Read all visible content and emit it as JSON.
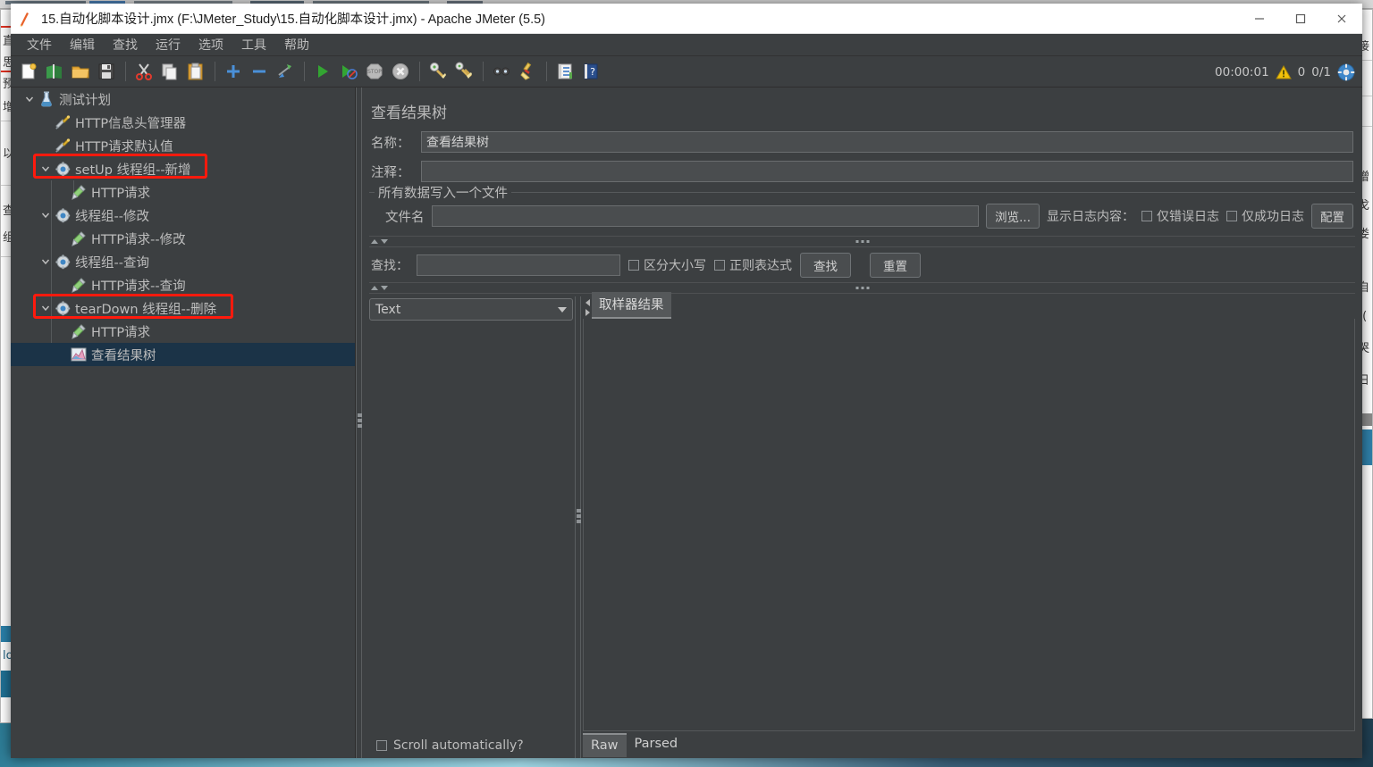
{
  "window": {
    "title": "15.自动化脚本设计.jmx (F:\\JMeter_Study\\15.自动化脚本设计.jmx) - Apache JMeter (5.5)",
    "minimize_label": "—",
    "maximize_label": "☐",
    "close_label": "✕"
  },
  "menubar": {
    "items": [
      {
        "label": "文件"
      },
      {
        "label": "编辑"
      },
      {
        "label": "查找"
      },
      {
        "label": "运行"
      },
      {
        "label": "选项"
      },
      {
        "label": "工具"
      },
      {
        "label": "帮助"
      }
    ]
  },
  "toolbar": {
    "buttons": [
      {
        "icon": "new-file-icon",
        "tooltip": "新建"
      },
      {
        "icon": "templates-icon",
        "tooltip": "模板"
      },
      {
        "icon": "open-folder-icon",
        "tooltip": "打开"
      },
      {
        "icon": "save-icon",
        "tooltip": "保存"
      },
      {
        "icon": "cut-icon",
        "tooltip": "剪切"
      },
      {
        "icon": "copy-icon",
        "tooltip": "复制"
      },
      {
        "icon": "paste-icon",
        "tooltip": "粘贴"
      },
      {
        "icon": "expand-all-icon",
        "tooltip": "展开"
      },
      {
        "icon": "collapse-all-icon",
        "tooltip": "折叠"
      },
      {
        "icon": "toggle-icon",
        "tooltip": "切换"
      },
      {
        "icon": "start-icon",
        "tooltip": "启动"
      },
      {
        "icon": "start-no-pauses-icon",
        "tooltip": "无间隔启动"
      },
      {
        "icon": "stop-icon",
        "tooltip": "停止"
      },
      {
        "icon": "shutdown-icon",
        "tooltip": "关闭"
      },
      {
        "icon": "clear-icon",
        "tooltip": "清除"
      },
      {
        "icon": "clear-all-icon",
        "tooltip": "清除全部"
      },
      {
        "icon": "search-icon",
        "tooltip": "搜索"
      },
      {
        "icon": "reset-search-icon",
        "tooltip": "重置搜索"
      },
      {
        "icon": "function-helper-icon",
        "tooltip": "函数助手"
      },
      {
        "icon": "help-icon",
        "tooltip": "帮助"
      }
    ]
  },
  "status": {
    "timer": "00:00:01",
    "warning_icon": "warning-triangle-icon",
    "warning_count": "0",
    "threads": "0/1",
    "connection_icon": "connection-icon"
  },
  "tree": {
    "nodes": [
      {
        "label": "测试计划",
        "icon": "test-plan-icon",
        "indent": 0,
        "twisty": "expanded",
        "selected": false,
        "annotated": false
      },
      {
        "label": "HTTP信息头管理器",
        "icon": "header-manager-icon",
        "indent": 1,
        "twisty": "none",
        "selected": false,
        "annotated": false
      },
      {
        "label": "HTTP请求默认值",
        "icon": "http-defaults-icon",
        "indent": 1,
        "twisty": "none",
        "selected": false,
        "annotated": false
      },
      {
        "label": "setUp 线程组--新增",
        "icon": "thread-group-icon",
        "indent": 1,
        "twisty": "expanded",
        "selected": false,
        "annotated": true
      },
      {
        "label": "HTTP请求",
        "icon": "http-sampler-icon",
        "indent": 2,
        "twisty": "none",
        "selected": false,
        "annotated": false
      },
      {
        "label": "线程组--修改",
        "icon": "thread-group-icon",
        "indent": 1,
        "twisty": "expanded",
        "selected": false,
        "annotated": false
      },
      {
        "label": "HTTP请求--修改",
        "icon": "http-sampler-icon",
        "indent": 2,
        "twisty": "none",
        "selected": false,
        "annotated": false
      },
      {
        "label": "线程组--查询",
        "icon": "thread-group-icon",
        "indent": 1,
        "twisty": "expanded",
        "selected": false,
        "annotated": false
      },
      {
        "label": "HTTP请求--查询",
        "icon": "http-sampler-icon",
        "indent": 2,
        "twisty": "none",
        "selected": false,
        "annotated": false
      },
      {
        "label": "tearDown 线程组--删除",
        "icon": "thread-group-icon",
        "indent": 1,
        "twisty": "expanded",
        "selected": false,
        "annotated": true
      },
      {
        "label": "HTTP请求",
        "icon": "http-sampler-icon",
        "indent": 2,
        "twisty": "none",
        "selected": false,
        "annotated": false
      },
      {
        "label": "查看结果树",
        "icon": "view-results-tree-icon",
        "indent": 2,
        "twisty": "none",
        "selected": true,
        "annotated": false
      }
    ],
    "annotation_color": "#ff1a0d",
    "selection_color": "#1b3347"
  },
  "panel": {
    "title": "查看结果树",
    "name_label": "名称：",
    "name_value": "查看结果树",
    "comment_label": "注释：",
    "comment_value": "",
    "file_group_title": "所有数据写入一个文件",
    "filename_label": "文件名",
    "filename_value": "",
    "browse_button": "浏览...",
    "log_display_label": "显示日志内容：",
    "errors_only_label": "仅错误日志",
    "errors_only_checked": false,
    "success_only_label": "仅成功日志",
    "success_only_checked": false,
    "configure_button": "配置"
  },
  "search": {
    "label": "查找：",
    "value": "",
    "case_sensitive_label": "区分大小写",
    "case_sensitive_checked": false,
    "regex_label": "正则表达式",
    "regex_checked": false,
    "search_button": "查找",
    "reset_button": "重置"
  },
  "lower": {
    "renderer_selected": "Text",
    "scroll_auto_label": "Scroll automatically?",
    "scroll_auto_checked": false,
    "result_tab": "取样器结果",
    "raw_tabs": [
      {
        "label": "Raw",
        "active": true
      },
      {
        "label": "Parsed",
        "active": false
      }
    ]
  },
  "colors": {
    "window_bg": "#3c3f41",
    "text": "#bdbdbd",
    "field_bg": "#4a4d4f",
    "accent_red": "#ff1a0d",
    "selection": "#1b3347"
  }
}
